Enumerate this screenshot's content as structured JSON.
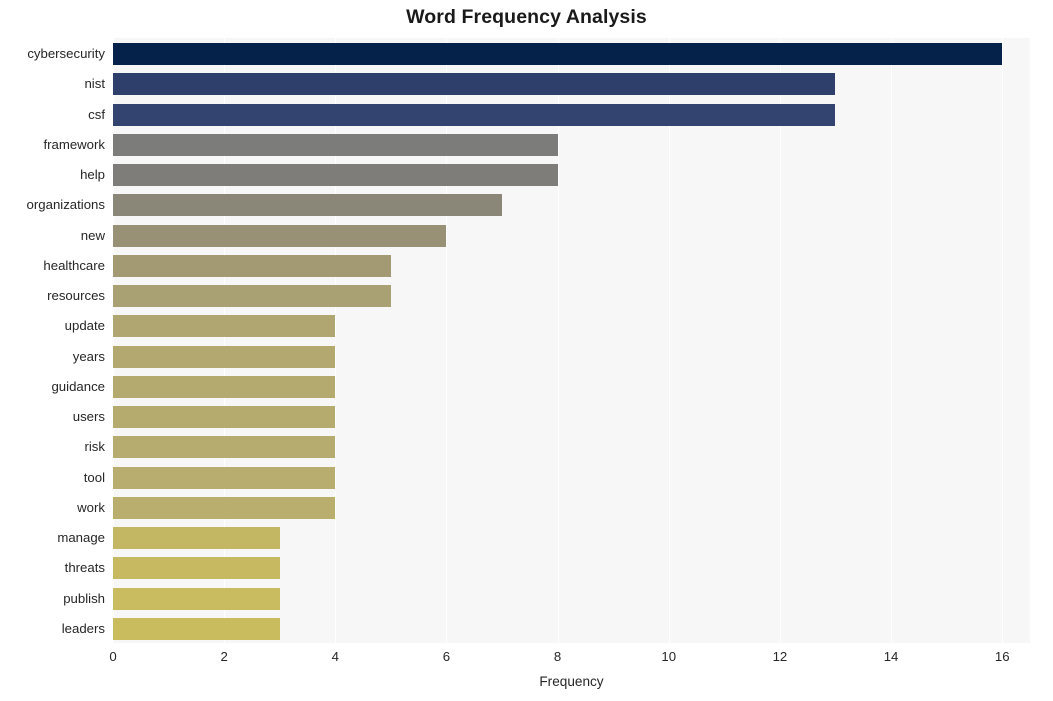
{
  "chart_data": {
    "type": "bar",
    "orientation": "horizontal",
    "title": "Word Frequency Analysis",
    "xlabel": "Frequency",
    "ylabel": "",
    "categories": [
      "cybersecurity",
      "nist",
      "csf",
      "framework",
      "help",
      "organizations",
      "new",
      "healthcare",
      "resources",
      "update",
      "years",
      "guidance",
      "users",
      "risk",
      "tool",
      "work",
      "manage",
      "threats",
      "publish",
      "leaders"
    ],
    "values": [
      16,
      13,
      13,
      8,
      8,
      7,
      6,
      5,
      5,
      4,
      4,
      4,
      4,
      4,
      4,
      4,
      3,
      3,
      3,
      3
    ],
    "bar_colors": [
      "#05234a",
      "#2e3f6b",
      "#334470",
      "#7c7c7b",
      "#7e7d79",
      "#8a8778",
      "#989175",
      "#a39a74",
      "#a9a073",
      "#b0a671",
      "#b2a870",
      "#b4aa70",
      "#b6ab6f",
      "#b7ac6f",
      "#b8ad6e",
      "#b9ae6e",
      "#c4b764",
      "#c6b962",
      "#c8bb60",
      "#c9bc5f"
    ],
    "xlim": [
      0,
      16.5
    ],
    "xticks": [
      0,
      2,
      4,
      6,
      8,
      10,
      12,
      14,
      16
    ],
    "xtick_labels": [
      "0",
      "2",
      "4",
      "6",
      "8",
      "10",
      "12",
      "14",
      "16"
    ],
    "grid": true,
    "grid_axis": "x",
    "legend": null,
    "plot_background": "#f7f7f7",
    "figure_background": "#ffffff",
    "gridline_color": "#ffffff",
    "tick_label_color": "#262626",
    "title_color": "#1a1a1a"
  }
}
